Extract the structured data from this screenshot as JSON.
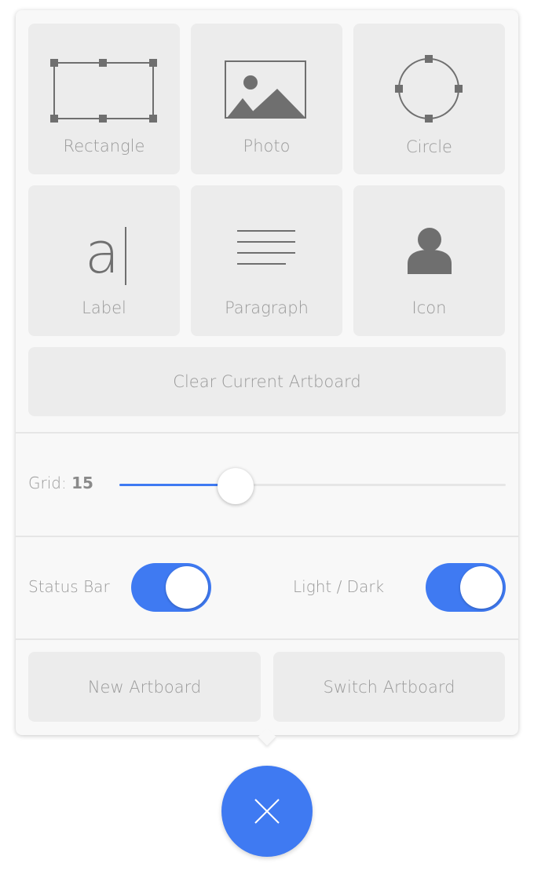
{
  "colors": {
    "accent": "#3f7af2",
    "tile_background": "#ececec",
    "panel_background": "#f8f8f8",
    "icon_gray": "#6f6f6f",
    "label_gray": "#9a9a9a"
  },
  "shape_tiles": [
    {
      "label": "Rectangle",
      "icon": "rectangle-icon"
    },
    {
      "label": "Photo",
      "icon": "photo-icon"
    },
    {
      "label": "Circle",
      "icon": "circle-icon"
    },
    {
      "label": "Label",
      "icon": "text-cursor-icon",
      "icon_text": "a"
    },
    {
      "label": "Paragraph",
      "icon": "paragraph-lines-icon"
    },
    {
      "label": "Icon",
      "icon": "user-icon"
    }
  ],
  "clear_button": {
    "label": "Clear Current Artboard"
  },
  "grid": {
    "label": "Grid:",
    "value": "15",
    "slider_fraction": 0.3
  },
  "toggles": [
    {
      "label": "Status Bar",
      "on": true
    },
    {
      "label": "Light / Dark",
      "on": true
    }
  ],
  "artboard_buttons": {
    "new_label": "New Artboard",
    "switch_label": "Switch Artboard"
  },
  "fab": {
    "icon": "close-icon"
  }
}
